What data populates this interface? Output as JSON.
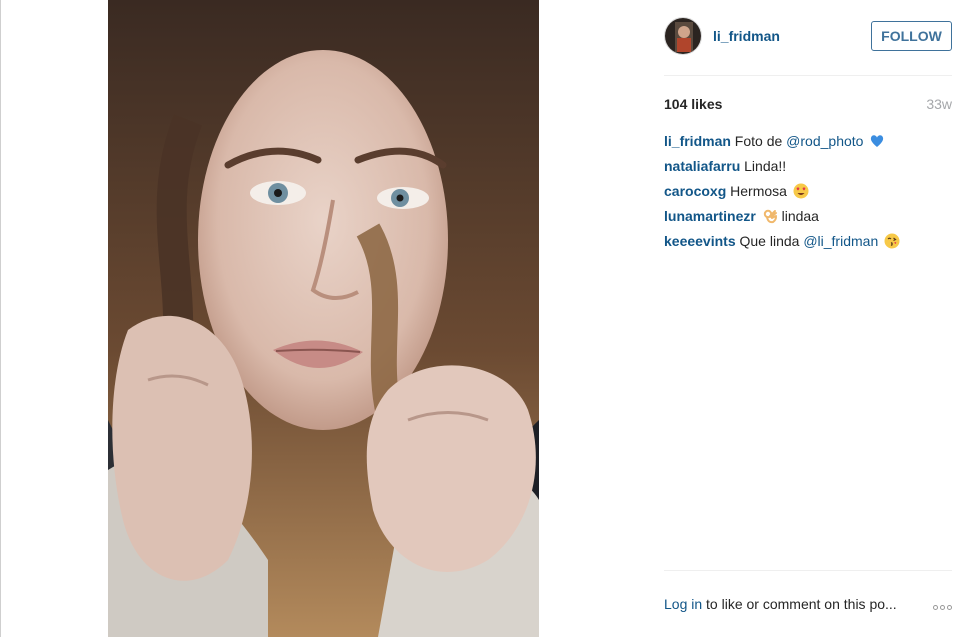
{
  "post": {
    "username": "li_fridman",
    "follow_label": "FOLLOW",
    "likes": "104 likes",
    "time_ago": "33w",
    "comments": [
      {
        "user": "li_fridman",
        "text": "Foto de ",
        "mention": "@rod_photo",
        "after": "",
        "emoji": "blue-heart-icon"
      },
      {
        "user": "nataliafarru",
        "text": "Linda!!",
        "mention": "",
        "after": "",
        "emoji": ""
      },
      {
        "user": "carocoxg",
        "text": "Hermosa ",
        "mention": "",
        "after": "",
        "emoji": "heart-eyes-icon"
      },
      {
        "user": "lunamartinezr",
        "text": "lindaa",
        "mention": "",
        "after": "",
        "emoji": "ok-hand-icon"
      },
      {
        "user": "keeeevints",
        "text": "Que linda ",
        "mention": "@li_fridman",
        "after": "",
        "emoji": "kiss-face-icon"
      }
    ],
    "footer": {
      "login_link": "Log in",
      "login_rest": " to like or comment on this po..."
    },
    "colors": {
      "link": "#125688",
      "follow_border": "#3f729b",
      "muted": "#a5a7aa"
    }
  }
}
